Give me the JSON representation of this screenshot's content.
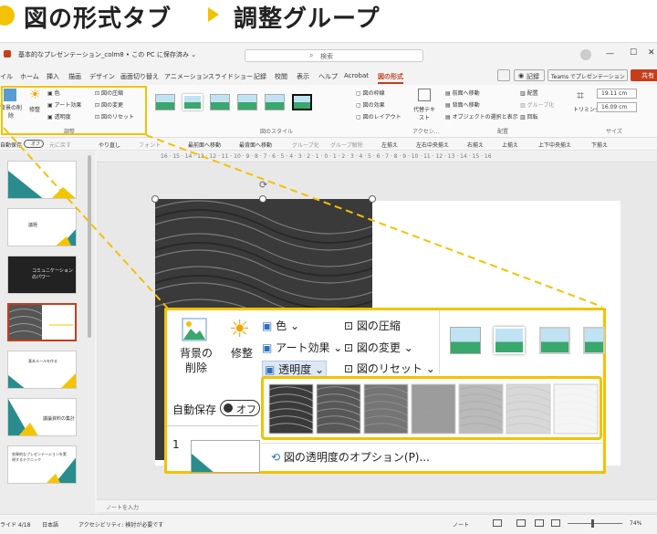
{
  "banner": {
    "left": "図の形式タブ",
    "right": "調整グループ"
  },
  "window": {
    "file_title": "基本的なプレゼンテーション_colm8 • この PC に保存済み ⌄",
    "search_placeholder": "検索",
    "menu": [
      "イル",
      "ホーム",
      "挿入",
      "描画",
      "デザイン",
      "画面切り替え",
      "アニメーション",
      "スライドショー",
      "記録",
      "校閲",
      "表示",
      "ヘルプ",
      "Acrobat",
      "図の形式"
    ],
    "record_label": "記録",
    "teams_label": "Teams でプレゼンテーション",
    "share_label": "共有"
  },
  "ribbon": {
    "remove_bg": "背景の削除",
    "correct": "修整",
    "color": "色",
    "art": "アート効果",
    "transparency": "透明度",
    "compress": "図の圧縮",
    "change": "図の変更",
    "reset": "図のリセット",
    "group_adjust": "調整",
    "group_styles": "図のスタイル",
    "border": "図の枠線",
    "effects": "図の効果",
    "layout": "図のレイアウト",
    "alt_text": "代替テキスト",
    "group_access": "アクセシ...",
    "bring_forward": "前面へ移動",
    "send_back": "背面へ移動",
    "selection": "オブジェクトの選択と表示",
    "align": "配置",
    "group": "グループ化",
    "rotate": "回転",
    "group_arrange": "配置",
    "crop": "トリミング",
    "height": "19.11 cm",
    "width": "16.09 cm",
    "group_size": "サイズ"
  },
  "qat": [
    "自動保存",
    "オフ",
    "元に戻す",
    "やり直し",
    "フォント",
    "最前面へ移動",
    "最背面へ移動",
    "グループ化",
    "グループ解除",
    "左揃え",
    "左右中央揃え",
    "右揃え",
    "上揃え",
    "上下中央揃え",
    "下揃え"
  ],
  "ruler_text": "16 · 15 · 14 · 13 · 12 · 11 · 10 · 9 · 8 · 7 · 6 · 5 · 4 · 3 · 2 · 1 · 0 · 1 · 2 · 3 · 4 · 5 · 6 · 7 · 8 · 9 · 10 · 11 · 12 · 13 · 14 · 15 · 16",
  "thumbs": [
    {
      "num": "1",
      "text": ""
    },
    {
      "num": "2",
      "text": "議題"
    },
    {
      "num": "3",
      "text": "コミュニケーションのパワー"
    },
    {
      "num": "4",
      "text": ""
    },
    {
      "num": "5",
      "text": "基本ルールを作る"
    },
    {
      "num": "6",
      "text": "議論資料の集計"
    },
    {
      "num": "7",
      "text": "効果的なプレゼンテーションを実現するテクニック"
    }
  ],
  "notes_label": "ノートを入力",
  "status": {
    "slide": "ライド 4/18",
    "lang": "日本語",
    "access": "アクセシビリティ: 検討が必要です",
    "notes": "ノート",
    "zoom": "74%"
  },
  "zoom_panel": {
    "remove_bg_1": "背景の",
    "remove_bg_2": "削除",
    "correct": "修整",
    "color": "色",
    "art": "アート効果",
    "transparency": "透明度",
    "compress": "図の圧縮",
    "change": "図の変更",
    "reset": "図のリセット",
    "autosave": "自動保存",
    "off": "オフ",
    "slide_num": "1",
    "option": "図の透明度のオプション(P)..."
  },
  "transparency_levels": [
    0,
    15,
    30,
    50,
    65,
    80,
    95
  ],
  "colors": {
    "accent": "#f2c200",
    "ppt_red": "#c43e1c",
    "teal": "#2a8c8c",
    "yellow": "#f5c400"
  }
}
